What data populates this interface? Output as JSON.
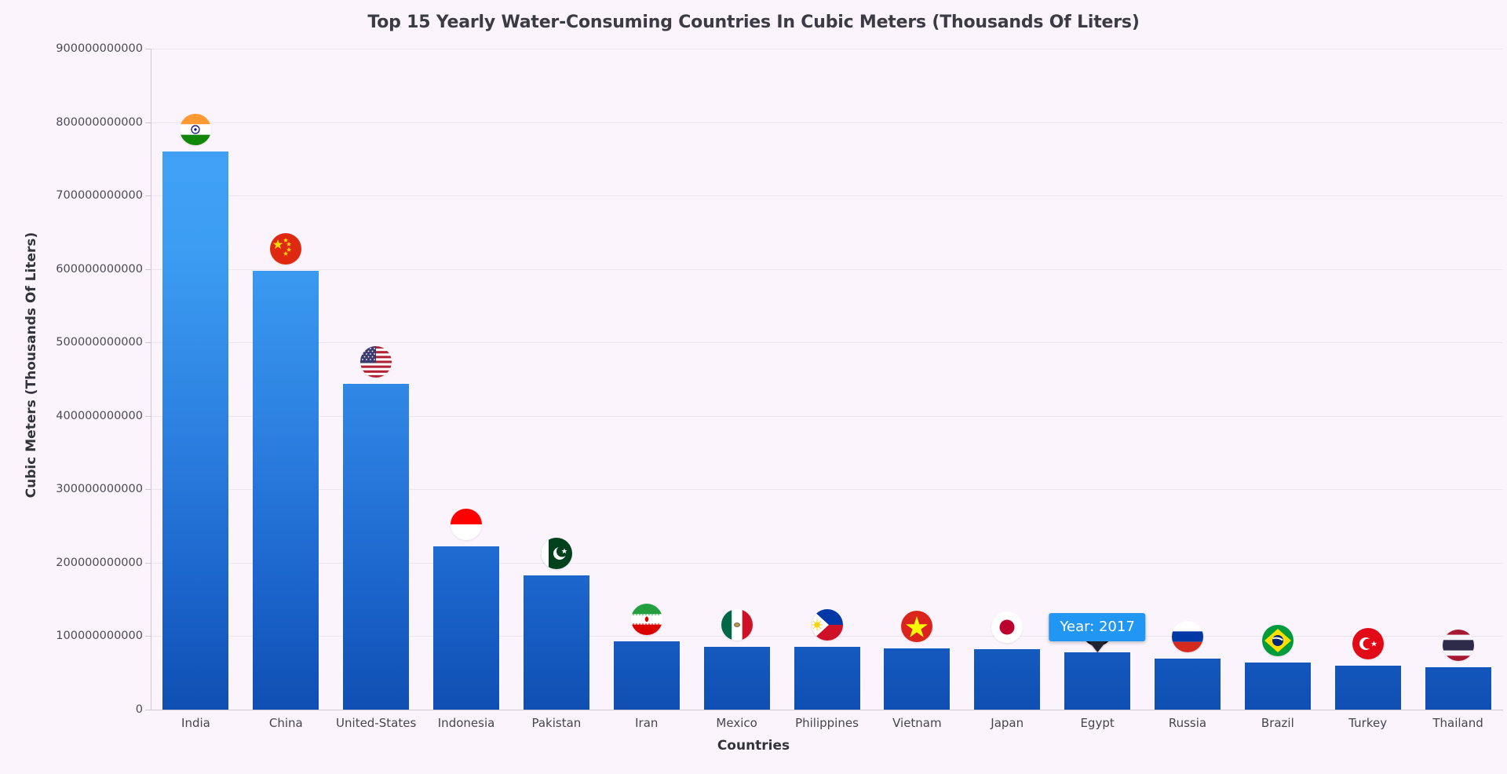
{
  "chart_data": {
    "type": "bar",
    "title": "Top 15 Yearly Water-Consuming Countries In Cubic Meters (Thousands Of Liters)",
    "xlabel": "Countries",
    "ylabel": "Cubic Meters (Thousands Of Liters)",
    "categories": [
      "India",
      "China",
      "United-States",
      "Indonesia",
      "Pakistan",
      "Iran",
      "Mexico",
      "Philippines",
      "Vietnam",
      "Japan",
      "Egypt",
      "Russia",
      "Brazil",
      "Turkey",
      "Thailand"
    ],
    "values": [
      760000000000,
      598000000000,
      444000000000,
      222000000000,
      183000000000,
      93000000000,
      86000000000,
      85000000000,
      83000000000,
      82000000000,
      78000000000,
      70000000000,
      64000000000,
      60000000000,
      58000000000
    ],
    "flags": [
      "india-flag-icon",
      "china-flag-icon",
      "united-states-flag-icon",
      "indonesia-flag-icon",
      "pakistan-flag-icon",
      "iran-flag-icon",
      "mexico-flag-icon",
      "philippines-flag-icon",
      "vietnam-flag-icon",
      "japan-flag-icon",
      "egypt-flag-icon",
      "russia-flag-icon",
      "brazil-flag-icon",
      "turkey-flag-icon",
      "thailand-flag-icon"
    ],
    "ylim": [
      0,
      900000000000
    ],
    "ytick_values": [
      0,
      100000000000,
      200000000000,
      300000000000,
      400000000000,
      500000000000,
      600000000000,
      700000000000,
      800000000000,
      900000000000
    ],
    "ytick_labels": [
      "0",
      "100000000000",
      "200000000000",
      "300000000000",
      "400000000000",
      "500000000000",
      "600000000000",
      "700000000000",
      "800000000000",
      "900000000000"
    ],
    "grid": true,
    "legend": "none",
    "bar_gradient": {
      "top": "#44a5f5",
      "bottom": "#0f4fb3"
    },
    "background": "#fcf4fd"
  },
  "tooltip": {
    "text": "Year: 2017",
    "anchor_category": "Egypt",
    "background": "#2196f3",
    "text_color": "#ffffff",
    "arrow_color": "#1f2430"
  }
}
